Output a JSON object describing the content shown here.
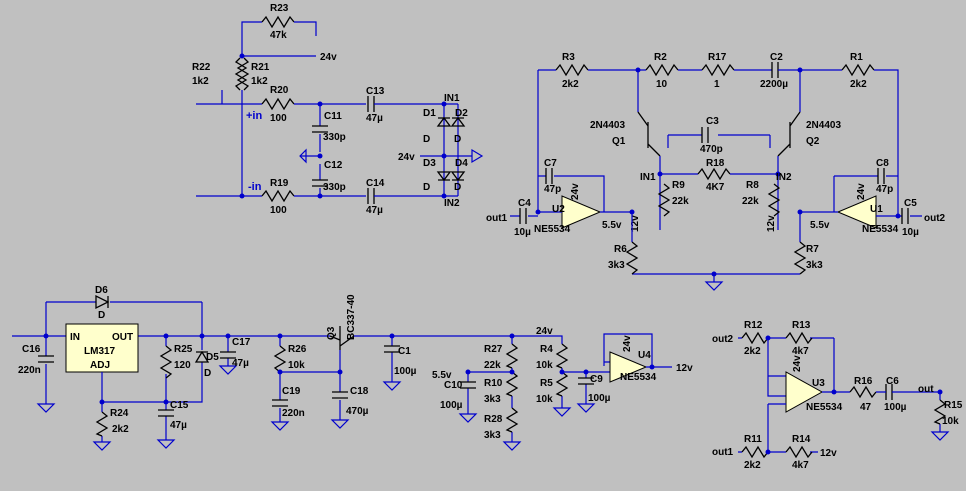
{
  "nets": {
    "v24": "24v",
    "v12": "12v",
    "v5_5": "5.5v",
    "plus_in": "+in",
    "minus_in": "-in",
    "in1": "IN1",
    "in2": "IN2",
    "out1": "out1",
    "out2": "out2",
    "out": "out"
  },
  "labels": {
    "R1": "R1",
    "R2": "R2",
    "R3": "R3",
    "R4": "R4",
    "R5": "R5",
    "R6": "R6",
    "R7": "R7",
    "R8": "R8",
    "R9": "R9",
    "R10": "R10",
    "R11": "R11",
    "R12": "R12",
    "R13": "R13",
    "R14": "R14",
    "R15": "R15",
    "R16": "R16",
    "R17": "R17",
    "R18": "R18",
    "R19": "R19",
    "R20": "R20",
    "R21": "R21",
    "R22": "R22",
    "R23": "R23",
    "R24": "R24",
    "R25": "R25",
    "R26": "R26",
    "R27": "R27",
    "R28": "R28",
    "C1": "C1",
    "C2": "C2",
    "C3": "C3",
    "C4": "C4",
    "C5": "C5",
    "C6": "C6",
    "C7": "C7",
    "C8": "C8",
    "C9": "C9",
    "C10": "C10",
    "C11": "C11",
    "C12": "C12",
    "C13": "C13",
    "C14": "C14",
    "C15": "C15",
    "C16": "C16",
    "C17": "C17",
    "C18": "C18",
    "C19": "C19",
    "D": "D",
    "D1": "D1",
    "D2": "D2",
    "D3": "D3",
    "D4": "D4",
    "D5": "D5",
    "D6": "D6",
    "Q1": "Q1",
    "Q2": "Q2",
    "Q3": "Q3",
    "Q_model": "2N4403",
    "BC337": "BC337-40",
    "U1": "U1",
    "U2": "U2",
    "U3": "U3",
    "U4": "U4",
    "LM317": "LM317",
    "pin_in": "IN",
    "pin_out": "OUT",
    "pin_adj": "ADJ"
  },
  "values": {
    "R1": "2k2",
    "R2": "10",
    "R3": "2k2",
    "R4": "10k",
    "R5": "10k",
    "R6": "3k3",
    "R7": "3k3",
    "R8": "22k",
    "R9": "22k",
    "R10": "3k3",
    "R11": "2k2",
    "R12": "2k2",
    "R13": "4k7",
    "R14": "4k7",
    "R15": "10k",
    "R16": "47",
    "R17": "1",
    "R18": "4K7",
    "R19": "100",
    "R20": "100",
    "R21": "1k2",
    "R22": "1k2",
    "R23": "47k",
    "R24": "2k2",
    "R25": "120",
    "R26": "10k",
    "R27": "22k",
    "R28": "3k3",
    "C1": "100µ",
    "C2": "2200µ",
    "C3": "470p",
    "C4": "10µ",
    "C5": "10µ",
    "C6": "100µ",
    "C7": "47p",
    "C8": "47p",
    "C9": "100µ",
    "C10": "100µ",
    "C11": "330p",
    "C12": "330p",
    "C13": "47µ",
    "C14": "47µ",
    "C15": "47µ",
    "C16": "220n",
    "C17": "47µ",
    "C18": "470µ",
    "C19": "220n",
    "U1": "NE5534",
    "U2": "NE5534",
    "U3": "NE5534",
    "U4": "NE5534"
  },
  "colors": {
    "background": "#c0c0c0",
    "wire": "#0000cc",
    "component": "#000000",
    "ic_fill": "#ffffcc"
  }
}
